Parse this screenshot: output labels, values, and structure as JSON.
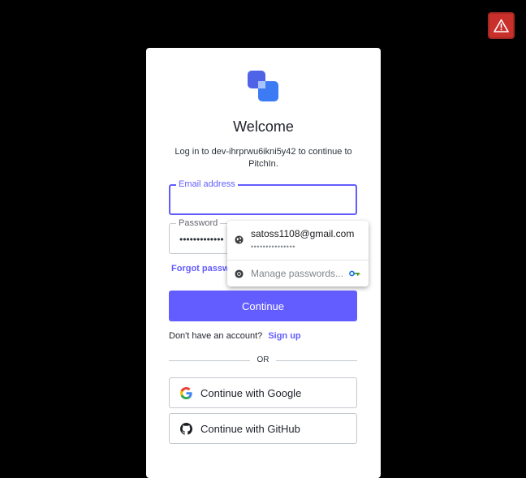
{
  "alert": {
    "icon": "warning-triangle-icon"
  },
  "login": {
    "title": "Welcome",
    "subtitle": "Log in to dev-ihrprwu6ikni5y42 to continue to PitchIn.",
    "email_label": "Email address",
    "email_value": "",
    "password_label": "Password",
    "password_value": "•••••••••••••",
    "forgot_label": "Forgot password?",
    "continue_label": "Continue",
    "no_account_text": "Don't have an account?",
    "signup_label": "Sign up",
    "or_text": "OR",
    "google_label": "Continue with Google",
    "github_label": "Continue with GitHub"
  },
  "password_popup": {
    "saved_email": "satoss1108@gmail.com",
    "saved_password_mask": "•••••••••••••••",
    "manage_label": "Manage passwords..."
  },
  "colors": {
    "accent": "#635dff",
    "alert": "#c9302c",
    "background": "#000000"
  }
}
